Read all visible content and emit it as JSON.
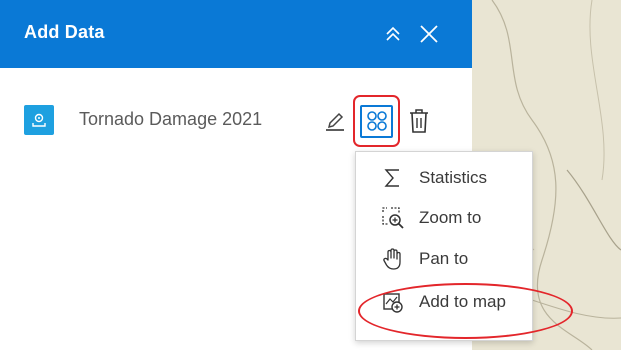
{
  "panel": {
    "title": "Add Data",
    "header_color": "#0a79d6",
    "collapse_icon": "double-chevron-up-icon",
    "close_icon": "close-icon"
  },
  "layer": {
    "name": "Tornado Damage 2021",
    "icon": "feature-layer-icon",
    "edit_icon": "pencil-icon",
    "actions_icon": "actions-grid-icon",
    "delete_icon": "trash-icon"
  },
  "menu": {
    "items": [
      {
        "label": "Statistics",
        "icon": "sigma-icon"
      },
      {
        "label": "Zoom to",
        "icon": "zoom-to-icon"
      },
      {
        "label": "Pan to",
        "icon": "hand-icon"
      },
      {
        "label": "Add to map",
        "icon": "add-to-map-icon"
      }
    ]
  },
  "annotation_color": "#e3262b"
}
